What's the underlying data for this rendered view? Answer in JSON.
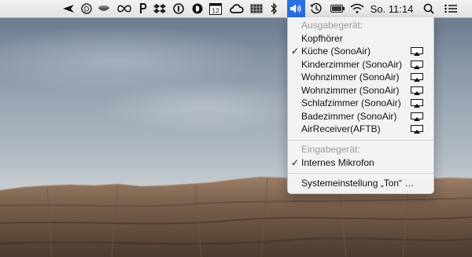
{
  "menubar": {
    "clock": "So. 11:14",
    "calendar_day": "12",
    "icons": [
      "navigation-arrow-icon",
      "d-circle-icon",
      "bowl-icon",
      "infinity-icon",
      "p-icon",
      "dropbox-icon",
      "i-circle-icon",
      "d-circle-filled-icon",
      "calendar-icon",
      "creative-cloud-icon",
      "keyboard-grid-icon",
      "bluetooth-icon",
      "volume-icon",
      "time-machine-icon",
      "battery-icon",
      "wifi-icon",
      "spotlight-search-icon",
      "notification-list-icon"
    ]
  },
  "audio_menu": {
    "output_header": "Ausgabegerät:",
    "output_devices": [
      {
        "label": "Kopfhörer",
        "checked": false,
        "airplay": false
      },
      {
        "label": "Küche (SonoAir)",
        "checked": true,
        "airplay": true
      },
      {
        "label": "Kinderzimmer (SonoAir)",
        "checked": false,
        "airplay": true
      },
      {
        "label": "Wohnzimmer (SonoAir)",
        "checked": false,
        "airplay": true
      },
      {
        "label": "Wohnzimmer (SonoAir)",
        "checked": false,
        "airplay": true
      },
      {
        "label": "Schlafzimmer (SonoAir)",
        "checked": false,
        "airplay": true
      },
      {
        "label": "Badezimmer (SonoAir)",
        "checked": false,
        "airplay": true
      },
      {
        "label": "AirReceiver(AFTB)",
        "checked": false,
        "airplay": true
      }
    ],
    "input_header": "Eingabegerät:",
    "input_devices": [
      {
        "label": "Internes Mikrofon",
        "checked": true
      }
    ],
    "system_prefs": "Systemeinstellung „Ton“ …",
    "checkmark": "✓"
  },
  "colors": {
    "menubar_bg": "#e8e8e8",
    "active_highlight": "#2a6fe0",
    "menu_bg": "#f4f4f4",
    "header_text": "#9a9a9a"
  }
}
